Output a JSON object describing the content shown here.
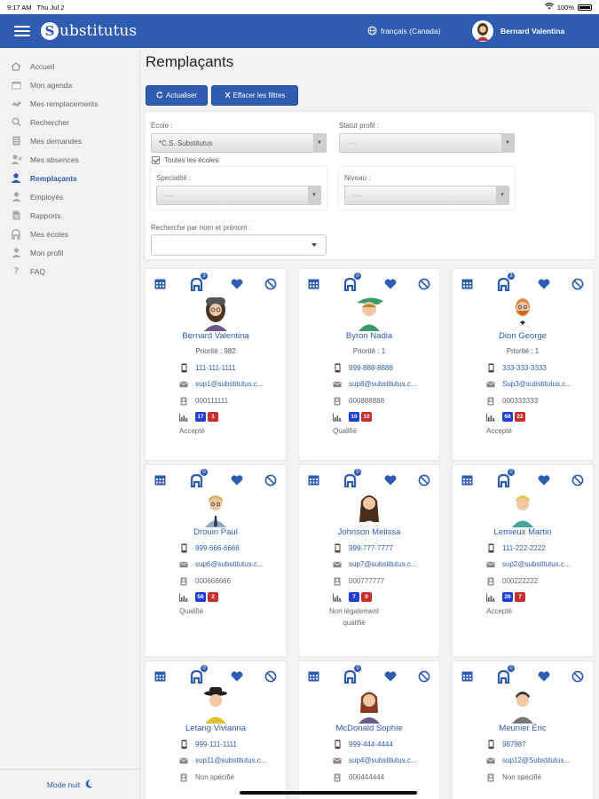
{
  "status_bar": {
    "time": "9:17 AM",
    "date": "Thu Jul 2",
    "battery": "100%"
  },
  "header": {
    "brand_letter": "S",
    "brand_rest": "ubstitutus",
    "language": "français (Canada)",
    "user_name": "Bernard Valentina"
  },
  "sidebar": {
    "items": [
      {
        "label": "Accueil",
        "icon": "home-icon"
      },
      {
        "label": "Mon agenda",
        "icon": "calendar-icon"
      },
      {
        "label": "Mes remplacements",
        "icon": "handshake-icon"
      },
      {
        "label": "Rechercher",
        "icon": "search-icon"
      },
      {
        "label": "Mes demandes",
        "icon": "document-icon"
      },
      {
        "label": "Mes absences",
        "icon": "user-absence-icon"
      },
      {
        "label": "Remplaçants",
        "icon": "users-icon",
        "active": true
      },
      {
        "label": "Employés",
        "icon": "user-icon"
      },
      {
        "label": "Rapports",
        "icon": "report-icon"
      },
      {
        "label": "Mes écoles",
        "icon": "school-icon"
      },
      {
        "label": "Mon profil",
        "icon": "profile-icon"
      },
      {
        "label": "FAQ",
        "icon": "question-icon"
      }
    ],
    "mode_nuit": "Mode nuit"
  },
  "page": {
    "title": "Remplaçants",
    "refresh_label": "Actualiser",
    "clear_filters_label": "Effacer les filtres"
  },
  "filters": {
    "ecole_label": "École :",
    "ecole_value": "*C.S. Substitutus",
    "statut_label": "Statut profil :",
    "statut_value": "----",
    "toutes_ecoles_label": "Toutes les écoles",
    "specialite_label": "Specialité :",
    "specialite_value": "----",
    "niveau_label": "Niveau :",
    "niveau_value": "----",
    "recherche_label": "Recherche par nom et prénom :"
  },
  "cards": [
    {
      "badge": "3",
      "name": "Bernard Valentina",
      "priority": "Priorité : 982",
      "phone": "111-111-1111",
      "email": "sup1@substitutus.c...",
      "id": "000111111",
      "blue": "17",
      "red": "1",
      "status": "Accepté",
      "avatar": "woman-beanie"
    },
    {
      "badge": "0",
      "name": "Byron Nadia",
      "priority": "Priorité : 1",
      "phone": "999-888-8888",
      "email": "sup8@substitutus.c...",
      "id": "000888888",
      "blue": "10",
      "red": "10",
      "status": "Qualifié",
      "avatar": "woman-green-hat"
    },
    {
      "badge": "3",
      "name": "Dion George",
      "priority": "Priorité : 1",
      "phone": "333-333-3333",
      "email": "Sup3@substitutus.c...",
      "id": "000333333",
      "blue": "68",
      "red": "22",
      "status": "Accepté",
      "avatar": "man-beard"
    },
    {
      "badge": "0",
      "name": "Drouin Paul",
      "phone": "999-666-6666",
      "email": "sup6@substitutus.c...",
      "id": "000666666",
      "blue": "56",
      "red": "2",
      "status": "Qualifié",
      "avatar": "man-tie"
    },
    {
      "badge": "0",
      "name": "Johnson Melissa",
      "phone": "999-777-7777",
      "email": "sup7@substitutus.c...",
      "id": "000777777",
      "blue": "7",
      "red": "0",
      "status": "Non légalement qualifié",
      "avatar": "woman-long-hair"
    },
    {
      "badge": "0",
      "name": "Lemieux Martin",
      "phone": "111-222-2222",
      "email": "sup2@substitutus.c...",
      "id": "000222222",
      "blue": "26",
      "red": "7",
      "status": "Accepté",
      "avatar": "man-blond"
    },
    {
      "badge": "0",
      "name": "Letang Vivianna",
      "phone": "999-111-1111",
      "email": "sup11@substitutus.c...",
      "id": "Non spécifié",
      "avatar": "woman-black-hat"
    },
    {
      "badge": "0",
      "name": "McDonald Sophie",
      "phone": "999-444-4444",
      "email": "sup4@substitutus.c...",
      "id": "000444444",
      "avatar": "woman-red-hair"
    },
    {
      "badge": "0",
      "name": "Meunier Éric",
      "phone": "987987",
      "email": "sup12@Substitutus...",
      "id": "Non spécifié",
      "avatar": "man-dark-hair"
    }
  ],
  "colors": {
    "primary": "#2e5cb0",
    "count_blue": "#1d3fd6",
    "count_red": "#c82f2f"
  }
}
